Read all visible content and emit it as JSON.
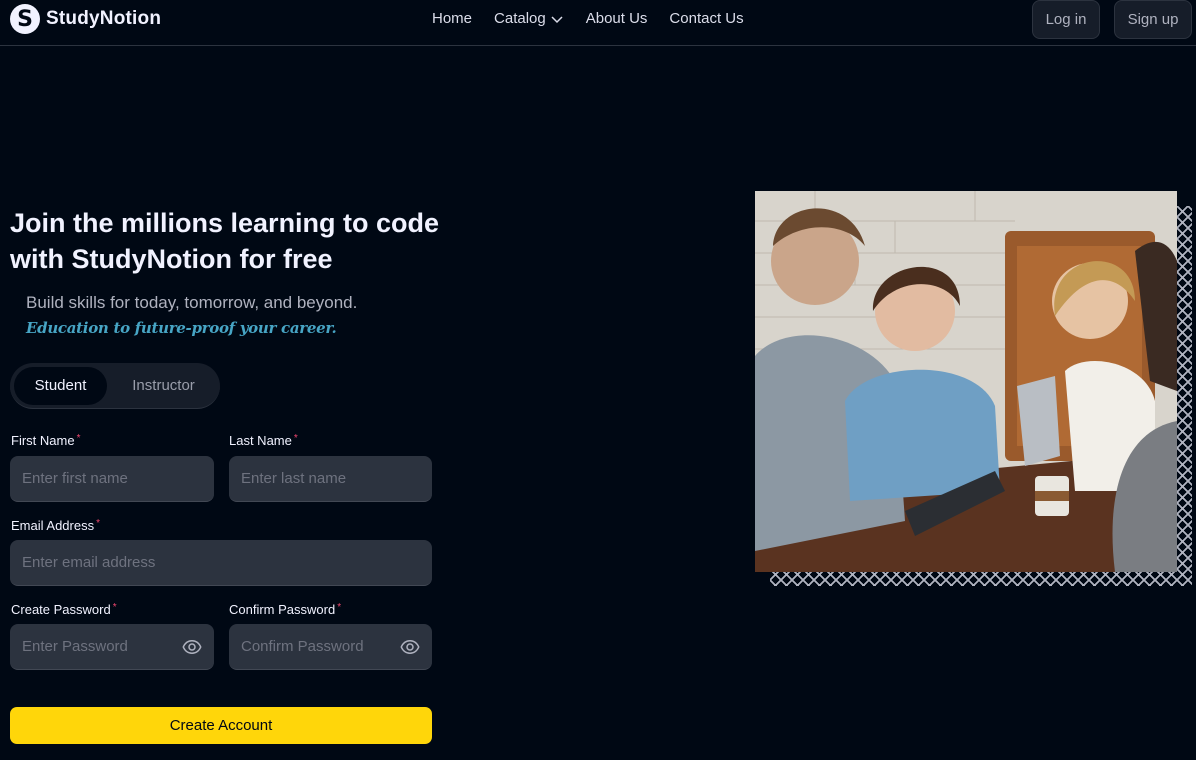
{
  "brand": {
    "name": "StudyNotion",
    "logo_letter": "S"
  },
  "nav": {
    "links": [
      {
        "label": "Home"
      },
      {
        "label": "Catalog"
      },
      {
        "label": "About Us"
      },
      {
        "label": "Contact Us"
      }
    ],
    "login_label": "Log in",
    "signup_label": "Sign up"
  },
  "hero": {
    "heading": "Join the millions learning to code with StudyNotion for free",
    "subtext": "Build skills for today, tomorrow, and beyond.",
    "tagline": "Education to future-proof your career."
  },
  "role_toggle": {
    "options": [
      "Student",
      "Instructor"
    ],
    "selected": "Student"
  },
  "form": {
    "first_name": {
      "label": "First Name",
      "placeholder": "Enter first name",
      "value": ""
    },
    "last_name": {
      "label": "Last Name",
      "placeholder": "Enter last name",
      "value": ""
    },
    "email": {
      "label": "Email Address",
      "placeholder": "Enter email address",
      "value": ""
    },
    "password": {
      "label": "Create Password",
      "placeholder": "Enter Password",
      "value": ""
    },
    "confirm_password": {
      "label": "Confirm Password",
      "placeholder": "Confirm Password",
      "value": ""
    },
    "required_mark": "*",
    "submit_label": "Create Account"
  },
  "icons": {
    "logo": "logo-icon",
    "catalog_dropdown": "chevron-down-icon",
    "password_visibility": "eye-icon"
  },
  "colors": {
    "background": "#000814",
    "accent_yellow": "#FFD60A",
    "tagline_blue": "#47A5C5",
    "required_red": "#EF476F",
    "field_bg": "#2C333F"
  }
}
